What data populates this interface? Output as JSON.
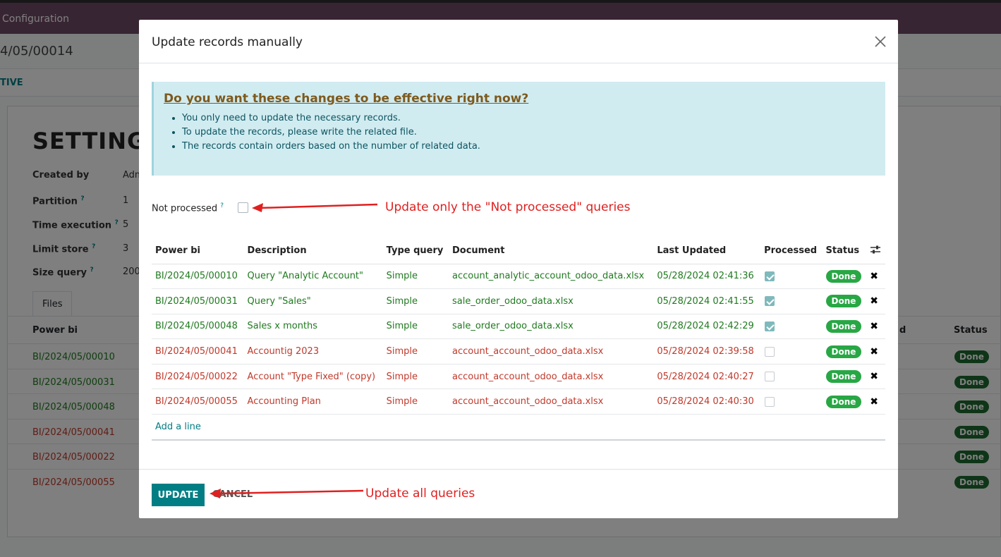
{
  "background": {
    "topbar_label": "Configuration",
    "crumb": "4/05/00014",
    "status_text": "TIVE",
    "title": "SETTING/",
    "fields": [
      {
        "label": "Created by",
        "value": "Adm"
      },
      {
        "label": "Partition",
        "value": "1"
      },
      {
        "label": "Time execution",
        "value": "5"
      },
      {
        "label": "Limit store",
        "value": "3"
      },
      {
        "label": "Size query",
        "value": "200"
      }
    ],
    "tab_files": "Files",
    "col_power_bi": "Power bi",
    "col_d": "d",
    "col_status": "Status",
    "rows": [
      {
        "pb": "BI/2024/05/00010",
        "status": "Done"
      },
      {
        "pb": "BI/2024/05/00031",
        "status": "Done"
      },
      {
        "pb": "BI/2024/05/00048",
        "status": "Done"
      },
      {
        "pb": "BI/2024/05/00041",
        "status": "Done"
      },
      {
        "pb": "BI/2024/05/00022",
        "status": "Done"
      },
      {
        "pb": "BI/2024/05/00055",
        "status": "Done"
      }
    ]
  },
  "modal": {
    "title": "Update records manually",
    "alert": {
      "heading": "Do you want these changes to be effective right now?",
      "items": [
        "You only need to update the necessary records.",
        "To update the records, please write the related file.",
        "The records contain orders based on the number of related data."
      ]
    },
    "not_processed_label": "Not processed",
    "help_mark": "?",
    "table": {
      "headers": [
        "Power bi",
        "Description",
        "Type query",
        "Document",
        "Last Updated",
        "Processed",
        "Status"
      ],
      "rows": [
        {
          "power_bi": "BI/2024/05/00010",
          "description": "Query \"Analytic Account\"",
          "type": "Simple",
          "document": "account_analytic_account_odoo_data.xlsx",
          "updated": "05/28/2024 02:41:36",
          "processed": true,
          "status": "Done"
        },
        {
          "power_bi": "BI/2024/05/00031",
          "description": "Query \"Sales\"",
          "type": "Simple",
          "document": "sale_order_odoo_data.xlsx",
          "updated": "05/28/2024 02:41:55",
          "processed": true,
          "status": "Done"
        },
        {
          "power_bi": "BI/2024/05/00048",
          "description": "Sales x months",
          "type": "Simple",
          "document": "sale_order_odoo_data.xlsx",
          "updated": "05/28/2024 02:42:29",
          "processed": true,
          "status": "Done"
        },
        {
          "power_bi": "BI/2024/05/00041",
          "description": "Accountig 2023",
          "type": "Simple",
          "document": "account_account_odoo_data.xlsx",
          "updated": "05/28/2024 02:39:58",
          "processed": false,
          "status": "Done"
        },
        {
          "power_bi": "BI/2024/05/00022",
          "description": "Account \"Type Fixed\" (copy)",
          "type": "Simple",
          "document": "account_account_odoo_data.xlsx",
          "updated": "05/28/2024 02:40:27",
          "processed": false,
          "status": "Done"
        },
        {
          "power_bi": "BI/2024/05/00055",
          "description": "Accounting Plan",
          "type": "Simple",
          "document": "account_account_odoo_data.xlsx",
          "updated": "05/28/2024 02:40:30",
          "processed": false,
          "status": "Done"
        }
      ],
      "add_line": "Add a line"
    },
    "update_button": "UPDATE",
    "cancel_button": "CANCEL"
  },
  "annotations": {
    "not_processed": "Update only the \"Not  processed\" queries",
    "update_all": "Update all queries"
  },
  "colors": {
    "processed_text": "#1f7a1f",
    "unprocessed_text": "#c0392b",
    "primary": "#017e84",
    "badge": "#28a745",
    "annotation": "#e02020"
  }
}
